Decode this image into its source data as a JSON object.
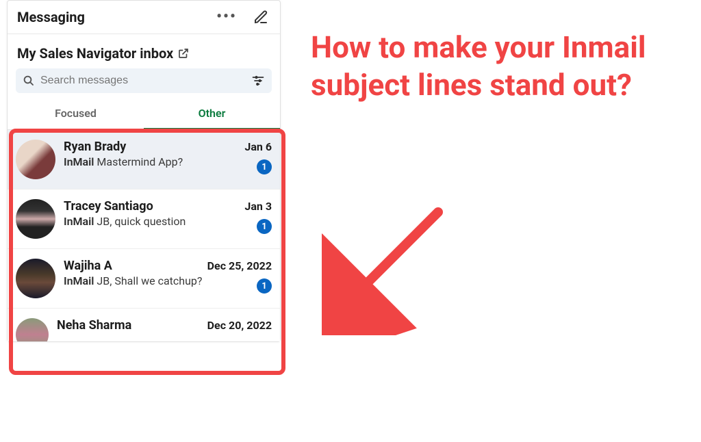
{
  "header": {
    "title": "Messaging"
  },
  "subheader": {
    "label": "My Sales Navigator inbox"
  },
  "search": {
    "placeholder": "Search messages"
  },
  "tabs": {
    "focused": "Focused",
    "other": "Other"
  },
  "messages": [
    {
      "name": "Ryan Brady",
      "date": "Jan 6",
      "tag": "InMail",
      "subject": "Mastermind App?",
      "badge": "1",
      "avatar_bg": "linear-gradient(135deg,#e9d6c8 40%,#7a3b3b 60%)"
    },
    {
      "name": "Tracey Santiago",
      "date": "Jan 3",
      "tag": "InMail",
      "subject": "JB, quick question",
      "badge": "1",
      "avatar_bg": "linear-gradient(180deg,#222 0%,#333 30%,#caa 50%,#222 70%)"
    },
    {
      "name": "Wajiha A",
      "date": "Dec 25, 2022",
      "tag": "InMail",
      "subject": "JB, Shall we catchup?",
      "badge": "1",
      "avatar_bg": "linear-gradient(180deg,#1a1a2a 0%, #4a3a2a 40%, #6a4a3a 60%, #1a1a2a 100%)"
    },
    {
      "name": "Neha Sharma",
      "date": "Dec 20, 2022",
      "tag": "",
      "subject": "",
      "badge": "",
      "avatar_bg": "linear-gradient(180deg,#8a9a7a 0%, #c08090 50%, #8a9a7a 100%)"
    }
  ],
  "callout": {
    "text": "How to make your Inmail subject lines stand out?"
  },
  "colors": {
    "accent_red": "#f04444",
    "badge_blue": "#0a66c2",
    "tab_green": "#0a7a3d"
  }
}
